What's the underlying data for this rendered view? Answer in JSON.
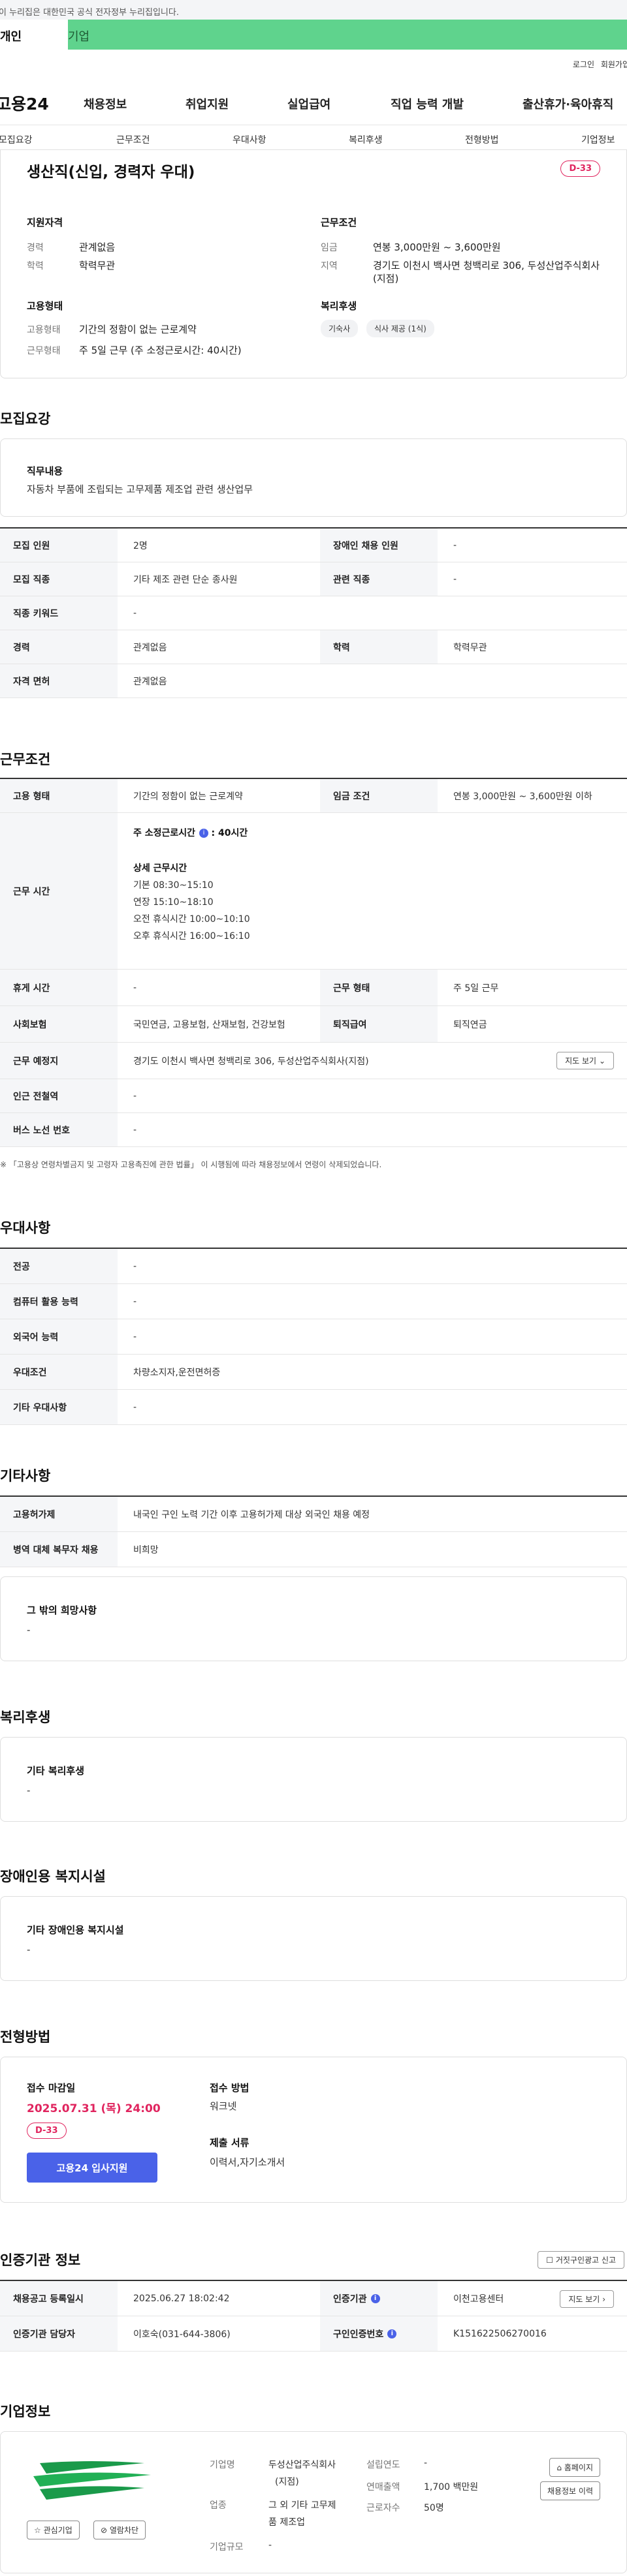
{
  "banner": {
    "text": "이 누리집은 대한민국 공식 전자정부 누리집입니다."
  },
  "user_tabs": {
    "person": "개인",
    "company": "기업"
  },
  "util": {
    "login": "로그인",
    "join": "회원가입"
  },
  "gnb": {
    "logo": "고용24",
    "menu": [
      "채용정보",
      "취업지원",
      "실업급여",
      "직업 능력 개발",
      "출산휴가·육아휴직"
    ]
  },
  "anchor_tabs": [
    "모집요강",
    "근무조건",
    "우대사항",
    "복리후생",
    "전형방법",
    "기업정보"
  ],
  "summary": {
    "title": "생산직(신입, 경력자 우대)",
    "dday": "D-33",
    "qual_title": "지원자격",
    "qual": [
      {
        "k": "경력",
        "v": "관계없음"
      },
      {
        "k": "학력",
        "v": "학력무관"
      }
    ],
    "employ_title": "고용형태",
    "employ": [
      {
        "k": "고용형태",
        "v": "기간의 정함이 없는 근로계약"
      },
      {
        "k": "근무형태",
        "v": "주 5일 근무 (주 소정근로시간: 40시간)"
      }
    ],
    "cond_title": "근무조건",
    "cond": [
      {
        "k": "임금",
        "v": "연봉 3,000만원 ~ 3,600만원"
      },
      {
        "k": "지역",
        "v": "경기도 이천시 백사면 청백리로 306, 두성산업주식회사"
      },
      {
        "k": "",
        "v": "(지점)"
      }
    ],
    "welfare_title": "복리후생",
    "chips": [
      "기숙사",
      "식사 제공 (1식)"
    ]
  },
  "recruit": {
    "title": "모집요강",
    "duty_label": "직무내용",
    "duty_value": "자동차 부품에 조립되는 고무제품 제조업 관련 생산업무",
    "rows": [
      {
        "th1": "모집 인원",
        "td1": "2명",
        "th2": "장애인 채용 인원",
        "td2": "-"
      },
      {
        "th1": "모집 직종",
        "td1": "기타 제조 관련 단순 종사원",
        "th2": "관련 직종",
        "td2": "-"
      },
      {
        "th1": "직종 키워드",
        "td1": "-"
      },
      {
        "th1": "경력",
        "td1": "관계없음",
        "th2": "학력",
        "td2": "학력무관"
      },
      {
        "th1": "자격 면허",
        "td1": "관계없음"
      }
    ]
  },
  "work": {
    "title": "근무조건",
    "employ_th": "고용 형태",
    "employ_td": "기간의 정함이 없는 근로계약",
    "wage_th": "임금 조건",
    "wage_td": "연봉 3,000만원 ~ 3,600만원 이하",
    "time_th": "근무 시간",
    "time_summary_label": "주 소정근로시간",
    "time_summary_value": ": 40시간",
    "time_detail_label": "상세 근무시간",
    "time_lines": [
      "기본 08:30~15:10",
      "연장 15:10~18:10",
      "오전 휴식시간 10:00~10:10",
      "오후 휴식시간 16:00~16:10"
    ],
    "rest_th": "휴게 시간",
    "rest_td": "-",
    "shape_th": "근무 형태",
    "shape_td": "주 5일 근무",
    "ins_th": "사회보험",
    "ins_td": "국민연금, 고용보험, 산재보험, 건강보험",
    "sev_th": "퇴직급여",
    "sev_td": "퇴직연금",
    "place_th": "근무 예정지",
    "place_td": "경기도 이천시 백사면 청백리로 306, 두성산업주식회사(지점)",
    "map_btn": "지도 보기",
    "station_th": "인근 전철역",
    "station_td": "-",
    "bus_th": "버스 노선 번호",
    "bus_td": "-",
    "note": "※ 「고용상 연령차별금지 및 고령자 고용촉진에 관한 법률」 이 시행됨에 따라 채용정보에서 연령이 삭제되었습니다."
  },
  "pref": {
    "title": "우대사항",
    "rows": [
      {
        "th": "전공",
        "td": "-"
      },
      {
        "th": "컴퓨터 활용 능력",
        "td": "-"
      },
      {
        "th": "외국어 능력",
        "td": "-"
      },
      {
        "th": "우대조건",
        "td": "차량소지자,운전면허증"
      },
      {
        "th": "기타 우대사항",
        "td": "-"
      }
    ]
  },
  "etc": {
    "title": "기타사항",
    "rows": [
      {
        "th": "고용허가제",
        "td": "내국인 구인 노력 기간 이후 고용허가제 대상 외국인 채용 예정"
      },
      {
        "th": "병역 대체 복무자 채용",
        "td": "비희망"
      }
    ],
    "hope_label": "그 밖의 희망사항",
    "hope_value": "-"
  },
  "welfare": {
    "title": "복리후생",
    "label": "기타 복리후생",
    "value": "-"
  },
  "disabled": {
    "title": "장애인용 복지시설",
    "label": "기타 장애인용 복지시설",
    "value": "-"
  },
  "selection": {
    "title": "전형방법",
    "deadline_label": "접수 마감일",
    "deadline_value": "2025.07.31 (목) 24:00",
    "dday": "D-33",
    "apply_btn": "고용24 입사지원",
    "method_label": "접수 방법",
    "method_value": "워크넷",
    "docs_label": "제출 서류",
    "docs_value": "이력서,자기소개서"
  },
  "cert": {
    "title": "인증기관 정보",
    "report_btn": "거짓구인광고 신고",
    "reg_th": "채용공고 등록일시",
    "reg_td": "2025.06.27 18:02:42",
    "agency_th": "인증기관",
    "agency_td": "이천고용센터",
    "map_btn": "지도 보기",
    "staff_th": "인증기관 담당자",
    "staff_td": "이호숙(031-644-3806)",
    "no_th": "구인인증번호",
    "no_td": "K151622506270016"
  },
  "company": {
    "title": "기업정보",
    "fav_btn": "관심기업",
    "block_btn": "열람차단",
    "name_k": "기업명",
    "name_v1": "두성산업주식회사",
    "name_v2": "(지점)",
    "ind_k": "업종",
    "ind_v1": "그 외 기타 고무제",
    "ind_v2": "품 제조업",
    "size_k": "기업규모",
    "size_v": "-",
    "est_k": "설립연도",
    "est_v": "-",
    "sales_k": "연매출액",
    "sales_v": "1,700 백만원",
    "emp_k": "근로자수",
    "emp_v": "50명",
    "home_btn": "홈페이지",
    "hist_btn": "채용정보 이력"
  },
  "colors": {
    "accent": "#4a62e8",
    "dday": "#e0245e",
    "company_tab": "#5fd38d"
  }
}
